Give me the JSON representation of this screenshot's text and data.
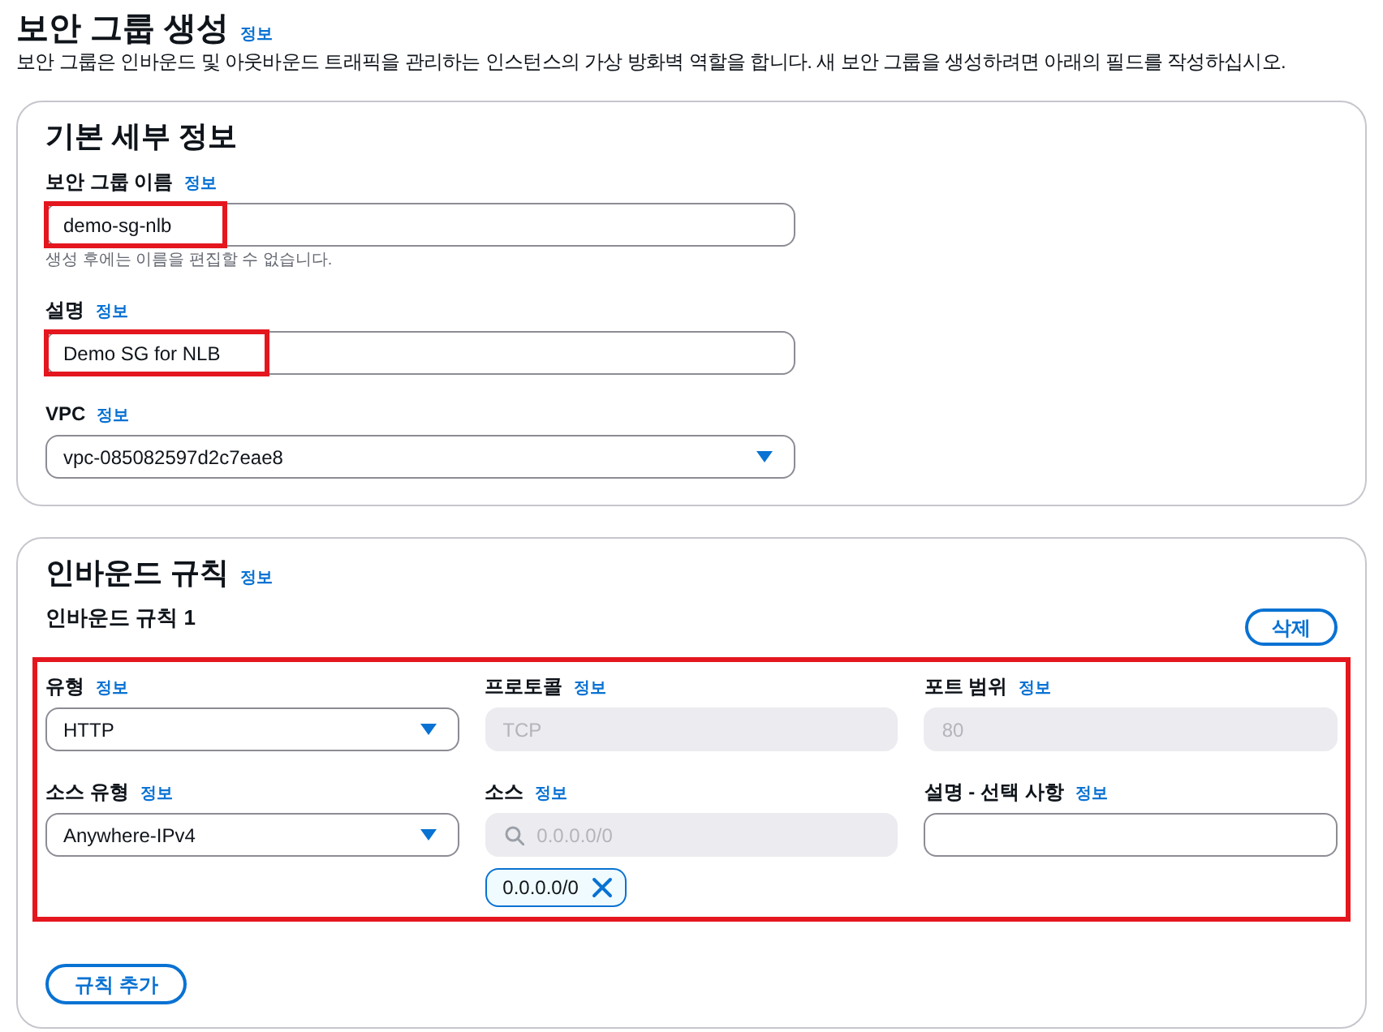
{
  "page": {
    "title": "보안 그룹 생성",
    "info_link": "정보",
    "description": "보안 그룹은 인바운드 및 아웃바운드 트래픽을 관리하는 인스턴스의 가상 방화벽 역할을 합니다. 새 보안 그룹을 생성하려면 아래의 필드를 작성하십시오."
  },
  "basic_details": {
    "heading": "기본 세부 정보",
    "fields": [
      {
        "kind": "text",
        "label": "보안 그룹 이름",
        "info_link": "정보",
        "value": "demo-sg-nlb",
        "hint": "생성 후에는 이름을 편집할 수 없습니다.",
        "disabled": false,
        "highlighted": true
      },
      {
        "kind": "text",
        "label": "설명",
        "info_link": "정보",
        "value": "Demo SG for NLB",
        "disabled": false,
        "highlighted": true
      },
      {
        "kind": "select",
        "label": "VPC",
        "info_link": "정보",
        "value": "vpc-085082597d2c7eae8",
        "disabled": false
      }
    ]
  },
  "inbound_rules": {
    "heading": "인바운드 규칙",
    "info_link": "정보",
    "rules": [
      {
        "title": "인바운드 규칙 1",
        "delete_button": "삭제",
        "highlighted": true,
        "fields": [
          {
            "kind": "select",
            "label": "유형",
            "info_link": "정보",
            "value": "HTTP",
            "disabled": false
          },
          {
            "kind": "text",
            "label": "프로토콜",
            "info_link": "정보",
            "value": "TCP",
            "disabled": true
          },
          {
            "kind": "text",
            "label": "포트 범위",
            "info_link": "정보",
            "value": "80",
            "disabled": true
          },
          {
            "kind": "select",
            "label": "소스 유형",
            "info_link": "정보",
            "value": "Anywhere-IPv4",
            "disabled": false
          },
          {
            "kind": "search",
            "label": "소스",
            "info_link": "정보",
            "placeholder": "0.0.0.0/0",
            "disabled": true,
            "tokens": [
              "0.0.0.0/0"
            ]
          },
          {
            "kind": "text",
            "label": "설명 - 선택 사항",
            "info_link": "정보",
            "disabled": false
          }
        ]
      }
    ],
    "add_button": "규칙 추가"
  }
}
